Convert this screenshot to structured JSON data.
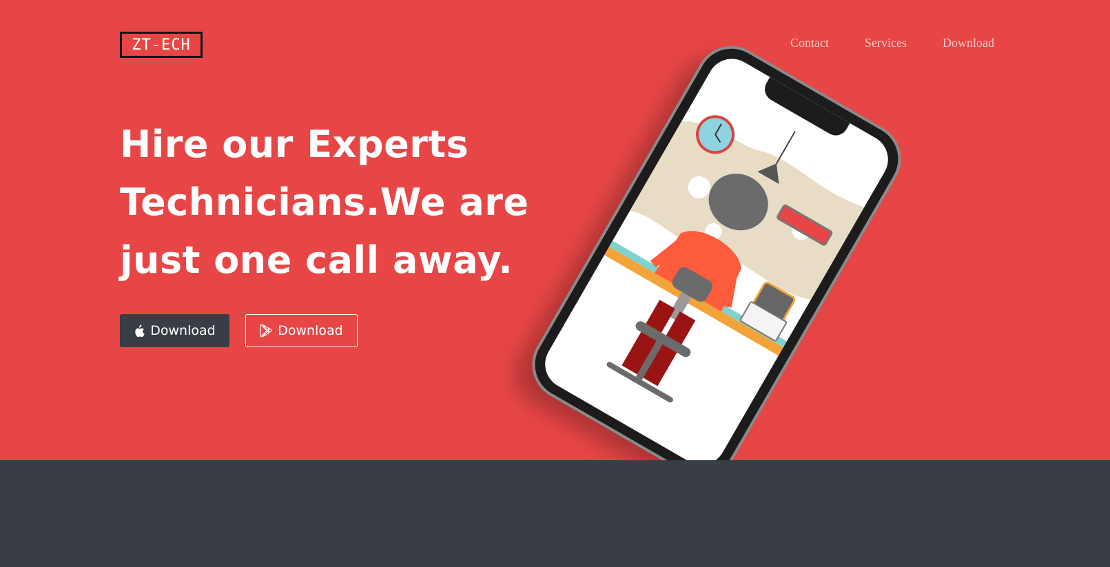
{
  "brand": {
    "logo_text": "ZT-ECH"
  },
  "nav": {
    "items": [
      "Contact",
      "Services",
      "Download"
    ]
  },
  "hero": {
    "headline_lines": [
      "Hire our Experts",
      "Technicians.We are",
      "just one call away."
    ],
    "buttons": {
      "ios_label": "Download",
      "android_label": "Download"
    }
  },
  "phone": {
    "illustration": "technician-workshop-illustration"
  },
  "colors": {
    "hero_bg": "#e84646",
    "footer_bg": "#393d45",
    "dark_button": "#393d45"
  },
  "icons": [
    "apple-icon",
    "google-play-icon"
  ]
}
